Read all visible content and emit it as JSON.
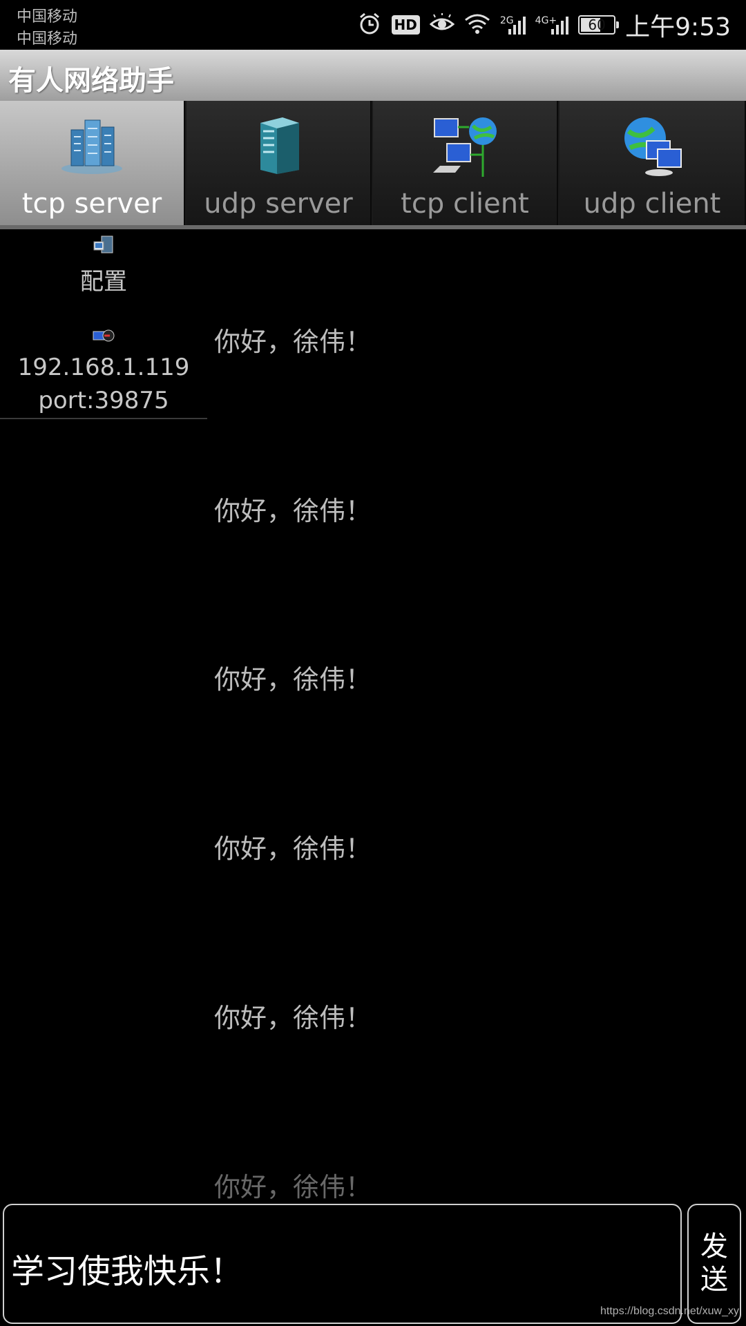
{
  "status_bar": {
    "carrier_1": "中国移动",
    "carrier_2": "中国移动",
    "hd_badge": "HD",
    "network_1": "2G",
    "network_2": "4G+",
    "battery": "60",
    "battery_level": 0.6,
    "time": "上午9:53",
    "icons": [
      "alarm-icon",
      "hd-icon",
      "eye-comfort-icon",
      "wifi-icon",
      "signal-2g-icon",
      "signal-4g-icon",
      "battery-icon"
    ]
  },
  "app": {
    "title": "有人网络助手"
  },
  "tabs": [
    {
      "label": "tcp server",
      "icon": "server-cluster-icon",
      "active": true
    },
    {
      "label": "udp server",
      "icon": "server-tower-icon",
      "active": false
    },
    {
      "label": "tcp client",
      "icon": "network-computers-globe-icon",
      "active": false
    },
    {
      "label": "udp client",
      "icon": "globe-computers-icon",
      "active": false
    }
  ],
  "sidebar": {
    "config_label": "配置",
    "client_ip": "192.168.1.119",
    "client_port": "port:39875"
  },
  "messages": [
    "你好，徐伟！",
    "你好，徐伟！",
    "你好，徐伟！",
    "你好，徐伟！",
    "你好，徐伟！",
    "你好，徐伟！"
  ],
  "input": {
    "value": "学习使我快乐！"
  },
  "send_button": {
    "label": "发\n送"
  },
  "watermark": "https://blog.csdn.net/xuw_xy",
  "colors": {
    "background": "#000000",
    "title_bar": "#bdbdbd",
    "active_tab": "#b0b0b0",
    "text": "#c8c8c8"
  }
}
